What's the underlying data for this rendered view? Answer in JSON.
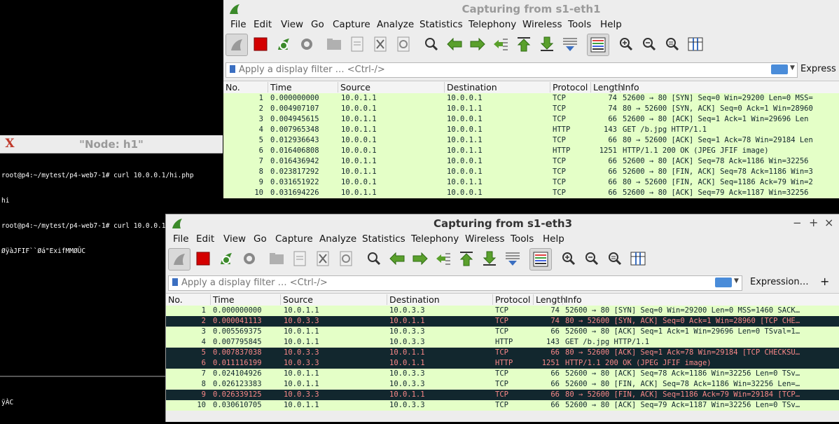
{
  "xterm": {
    "title": "\"Node: h1\"",
    "lines": [
      "root@p4:~/mytest/p4-web7-1# curl 10.0.0.1/hi.php",
      "hi",
      "root@p4:~/mytest/p4-web7-1# curl 10.0.0.1/b.jpg",
      "ØÿàJFIF``Øá\"ExifMMØÛC",
      "ÿÀC"
    ]
  },
  "menu": [
    "File",
    "Edit",
    "View",
    "Go",
    "Capture",
    "Analyze",
    "Statistics",
    "Telephony",
    "Wireless",
    "Tools",
    "Help"
  ],
  "filter_placeholder": "Apply a display filter … <Ctrl-/>",
  "columns": [
    "No.",
    "Time",
    "Source",
    "Destination",
    "Protocol",
    "Length",
    "Info"
  ],
  "colors": {
    "normal_bg": "#e4ffc7",
    "dark_bg": "#12272e",
    "dark_fg": "#f78787",
    "normal_fg": "#12272e"
  },
  "win1": {
    "title": "Capturing from s1-eth1",
    "expression_label": "Express",
    "rows": [
      {
        "no": "1",
        "time": "0.000000000",
        "src": "10.0.1.1",
        "dst": "10.0.0.1",
        "proto": "TCP",
        "len": "74",
        "info": "52600 → 80 [SYN] Seq=0 Win=29200 Len=0 MSS=",
        "dark": false
      },
      {
        "no": "2",
        "time": "0.004907107",
        "src": "10.0.0.1",
        "dst": "10.0.1.1",
        "proto": "TCP",
        "len": "74",
        "info": "80 → 52600 [SYN, ACK] Seq=0 Ack=1 Win=28960",
        "dark": false
      },
      {
        "no": "3",
        "time": "0.004945615",
        "src": "10.0.1.1",
        "dst": "10.0.0.1",
        "proto": "TCP",
        "len": "66",
        "info": "52600 → 80 [ACK] Seq=1 Ack=1 Win=29696 Len",
        "dark": false
      },
      {
        "no": "4",
        "time": "0.007965348",
        "src": "10.0.1.1",
        "dst": "10.0.0.1",
        "proto": "HTTP",
        "len": "143",
        "info": "GET /b.jpg HTTP/1.1",
        "dark": false
      },
      {
        "no": "5",
        "time": "0.012936643",
        "src": "10.0.0.1",
        "dst": "10.0.1.1",
        "proto": "TCP",
        "len": "66",
        "info": "80 → 52600 [ACK] Seq=1 Ack=78 Win=29184 Len",
        "dark": false
      },
      {
        "no": "6",
        "time": "0.016406808",
        "src": "10.0.0.1",
        "dst": "10.0.1.1",
        "proto": "HTTP",
        "len": "1251",
        "info": "HTTP/1.1 200 OK  (JPEG JFIF image)",
        "dark": false
      },
      {
        "no": "7",
        "time": "0.016436942",
        "src": "10.0.1.1",
        "dst": "10.0.0.1",
        "proto": "TCP",
        "len": "66",
        "info": "52600 → 80 [ACK] Seq=78 Ack=1186 Win=32256",
        "dark": false
      },
      {
        "no": "8",
        "time": "0.023817292",
        "src": "10.0.1.1",
        "dst": "10.0.0.1",
        "proto": "TCP",
        "len": "66",
        "info": "52600 → 80 [FIN, ACK] Seq=78 Ack=1186 Win=3",
        "dark": false
      },
      {
        "no": "9",
        "time": "0.031651922",
        "src": "10.0.0.1",
        "dst": "10.0.1.1",
        "proto": "TCP",
        "len": "66",
        "info": "80 → 52600 [FIN, ACK] Seq=1186 Ack=79 Win=2",
        "dark": false
      },
      {
        "no": "10",
        "time": "0.031694226",
        "src": "10.0.1.1",
        "dst": "10.0.0.1",
        "proto": "TCP",
        "len": "66",
        "info": "52600 → 80 [ACK] Seq=79 Ack=1187 Win=32256",
        "dark": false
      }
    ]
  },
  "win2": {
    "title": "Capturing from s1-eth3",
    "expression_label": "Expression…",
    "window_controls": [
      "−",
      "+",
      "×"
    ],
    "rows": [
      {
        "no": "1",
        "time": "0.000000000",
        "src": "10.0.1.1",
        "dst": "10.0.3.3",
        "proto": "TCP",
        "len": "74",
        "info": "52600 → 80 [SYN] Seq=0 Win=29200 Len=0 MSS=1460 SACK…",
        "dark": false
      },
      {
        "no": "2",
        "time": "0.000041113",
        "src": "10.0.3.3",
        "dst": "10.0.1.1",
        "proto": "TCP",
        "len": "74",
        "info": "80 → 52600 [SYN, ACK] Seq=0 Ack=1 Win=28960 [TCP CHE…",
        "dark": true
      },
      {
        "no": "3",
        "time": "0.005569375",
        "src": "10.0.1.1",
        "dst": "10.0.3.3",
        "proto": "TCP",
        "len": "66",
        "info": "52600 → 80 [ACK] Seq=1 Ack=1 Win=29696 Len=0 TSval=1…",
        "dark": false
      },
      {
        "no": "4",
        "time": "0.007795845",
        "src": "10.0.1.1",
        "dst": "10.0.3.3",
        "proto": "HTTP",
        "len": "143",
        "info": "GET /b.jpg HTTP/1.1",
        "dark": false
      },
      {
        "no": "5",
        "time": "0.007837038",
        "src": "10.0.3.3",
        "dst": "10.0.1.1",
        "proto": "TCP",
        "len": "66",
        "info": "80 → 52600 [ACK] Seq=1 Ack=78 Win=29184 [TCP CHECKSU…",
        "dark": true
      },
      {
        "no": "6",
        "time": "0.011116199",
        "src": "10.0.3.3",
        "dst": "10.0.1.1",
        "proto": "HTTP",
        "len": "1251",
        "info": "HTTP/1.1 200 OK  (JPEG JFIF image)",
        "dark": true
      },
      {
        "no": "7",
        "time": "0.024104926",
        "src": "10.0.1.1",
        "dst": "10.0.3.3",
        "proto": "TCP",
        "len": "66",
        "info": "52600 → 80 [ACK] Seq=78 Ack=1186 Win=32256 Len=0 TSv…",
        "dark": false
      },
      {
        "no": "8",
        "time": "0.026123383",
        "src": "10.0.1.1",
        "dst": "10.0.3.3",
        "proto": "TCP",
        "len": "66",
        "info": "52600 → 80 [FIN, ACK] Seq=78 Ack=1186 Win=32256 Len=…",
        "dark": false
      },
      {
        "no": "9",
        "time": "0.026339125",
        "src": "10.0.3.3",
        "dst": "10.0.1.1",
        "proto": "TCP",
        "len": "66",
        "info": "80 → 52600 [FIN, ACK] Seq=1186 Ack=79 Win=29184 [TCP…",
        "dark": true
      },
      {
        "no": "10",
        "time": "0.030610705",
        "src": "10.0.1.1",
        "dst": "10.0.3.3",
        "proto": "TCP",
        "len": "66",
        "info": "52600 → 80 [ACK] Seq=79 Ack=1187 Win=32256 Len=0 TSv…",
        "dark": false
      }
    ]
  }
}
